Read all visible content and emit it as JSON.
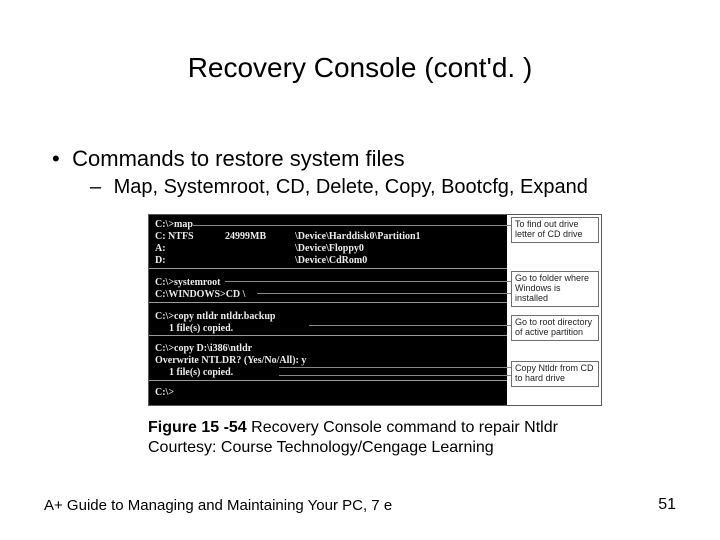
{
  "title": "Recovery Console (cont'd. )",
  "bullets": {
    "b1_marker": "•",
    "b1_text": "Commands to restore system files",
    "b2_marker": "–",
    "b2_text": "Map, Systemroot, CD, Delete, Copy, Bootcfg, Expand"
  },
  "terminal": {
    "l1": "C:\\>map",
    "l2a": "C:  NTFS",
    "l2b": "24999MB",
    "l2c": "\\Device\\Harddisk0\\Partition1",
    "l3": "A:",
    "l3b": "\\Device\\Floppy0",
    "l4": "D:",
    "l4b": "\\Device\\CdRom0",
    "l5": "C:\\>systemroot",
    "l6": "C:\\WINDOWS>CD \\",
    "l7": "C:\\>copy ntldr ntldr.backup",
    "l8": "1 file(s) copied.",
    "l9": "C:\\>copy D:\\i386\\ntldr",
    "l10": "Overwrite NTLDR? (Yes/No/All): y",
    "l11": "1 file(s) copied.",
    "l12": "C:\\>"
  },
  "callouts": {
    "c1": "To find out drive letter of CD drive",
    "c2": "Go to folder where Windows is installed",
    "c3": "Go to root directory of active partition",
    "c4": "Copy Ntldr from CD to hard drive"
  },
  "caption": {
    "label": "Figure 15 -54",
    "text": " Recovery Console command to repair Ntldr",
    "credit": "Courtesy: Course Technology/Cengage Learning"
  },
  "footer": {
    "left": "A+ Guide to Managing and Maintaining Your PC, 7 e",
    "page": "51"
  }
}
